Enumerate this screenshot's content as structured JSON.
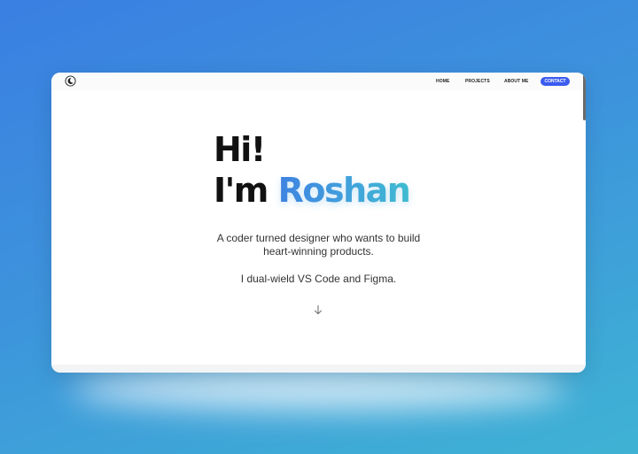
{
  "nav": {
    "home": "HOME",
    "projects": "PROJECTS",
    "about": "ABOUT ME",
    "contact": "CONTACT"
  },
  "hero": {
    "line1": "Hi!",
    "line2_prefix": "I'm ",
    "name": "Roshan"
  },
  "tagline": {
    "line1": "A coder turned designer who wants to build",
    "line2": "heart-winning products.",
    "line3": "I dual-wield VS Code and Figma."
  },
  "icons": {
    "logo": "moon-icon",
    "scroll": "arrow-down-icon"
  },
  "colors": {
    "background_start": "#3a7fe2",
    "background_end": "#3fb3d4",
    "contact_button": "#3b5cf0",
    "name_gradient_start": "#3f7fe3",
    "name_gradient_end": "#3fc0cf"
  }
}
